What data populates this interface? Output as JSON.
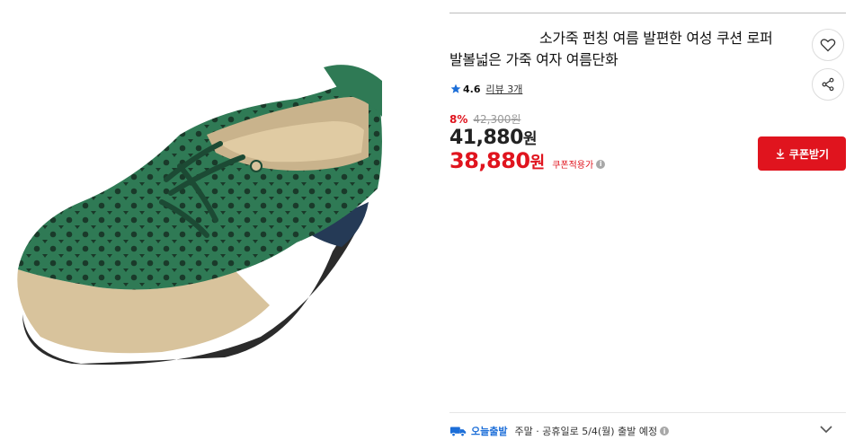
{
  "product": {
    "title_line1": "소가죽 펀칭 여름 발편한 여성 쿠션 로퍼",
    "title_line2": "발볼넓은 가죽 여자 여름단화",
    "image_alt": "green perforated leather loafer"
  },
  "rating": {
    "score": "4.6",
    "reviews_label": "리뷰 3개"
  },
  "pricing": {
    "discount_rate": "8%",
    "original_price": "42,300원",
    "sale_price": "41,880",
    "sale_unit": "원",
    "coupon_price": "38,880",
    "coupon_unit": "원",
    "coupon_label": "쿠폰적용가"
  },
  "actions": {
    "coupon_button": "쿠폰받기"
  },
  "shipping": {
    "badge": "오늘출발",
    "text": "주말 · 공휴일로 5/4(월) 출발 예정"
  },
  "icons": {
    "wishlist": "heart-icon",
    "share": "share-icon",
    "star": "star-icon",
    "download": "download-icon",
    "truck": "truck-icon",
    "chevron": "chevron-down-icon",
    "info": "info-icon"
  },
  "colors": {
    "accent_red": "#e0141e",
    "shipping_blue": "#1c6ed8",
    "shoe_green": "#2f7a55",
    "shoe_beige": "#d8c39c"
  }
}
